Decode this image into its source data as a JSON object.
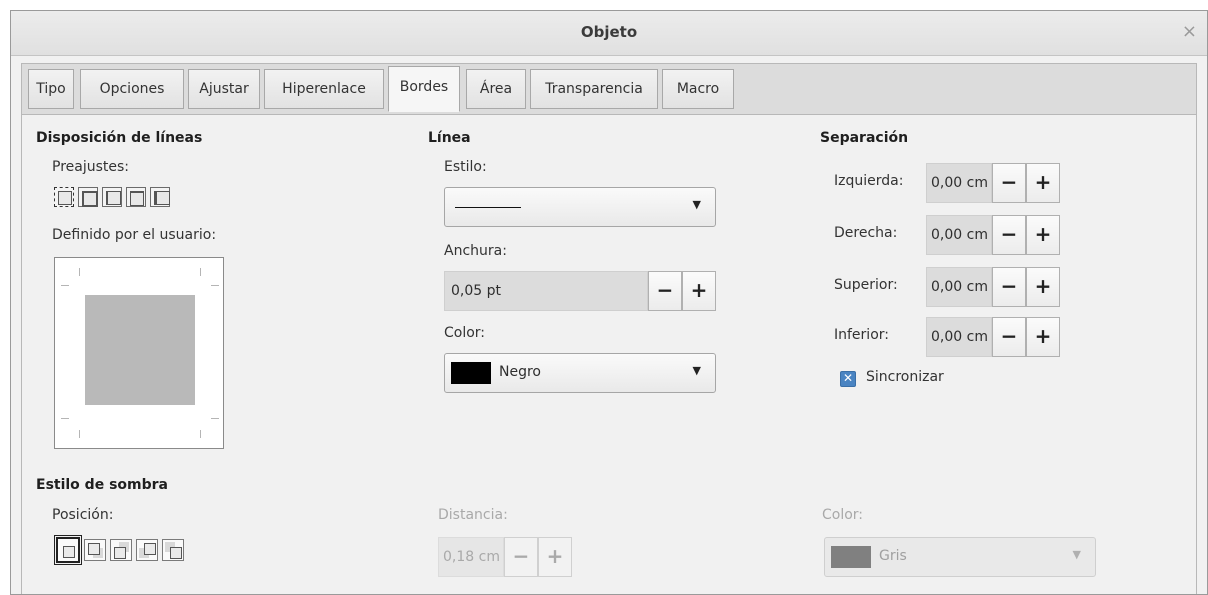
{
  "window": {
    "title": "Objeto",
    "close_glyph": "×"
  },
  "tabs": [
    {
      "label": "Tipo"
    },
    {
      "label": "Opciones"
    },
    {
      "label": "Ajustar"
    },
    {
      "label": "Hiperenlace"
    },
    {
      "label": "Bordes"
    },
    {
      "label": "Área"
    },
    {
      "label": "Transparencia"
    },
    {
      "label": "Macro"
    }
  ],
  "active_tab": "Bordes",
  "line_arrangement": {
    "heading": "Disposición de líneas",
    "presets_label": "Preajustes:",
    "user_defined_label": "Definido por el usuario:"
  },
  "line": {
    "heading": "Línea",
    "style_label": "Estilo:",
    "width_label": "Anchura:",
    "width_value": "0,05 pt",
    "color_label": "Color:",
    "color_value": "Negro",
    "color_swatch": "#000000"
  },
  "spacing": {
    "heading": "Separación",
    "left_label": "Izquierda:",
    "left_value": "0,00 cm",
    "right_label": "Derecha:",
    "right_value": "0,00 cm",
    "top_label": "Superior:",
    "top_value": "0,00 cm",
    "bottom_label": "Inferior:",
    "bottom_value": "0,00 cm",
    "sync_label": "Sincronizar",
    "sync_checked": true
  },
  "shadow": {
    "heading": "Estilo de sombra",
    "position_label": "Posición:",
    "distance_label": "Distancia:",
    "distance_value": "0,18 cm",
    "color_label": "Color:",
    "color_value": "Gris",
    "color_swatch": "#808080"
  },
  "glyphs": {
    "minus": "−",
    "plus": "+",
    "dropdown_arrow": "▼",
    "check": "✕"
  }
}
